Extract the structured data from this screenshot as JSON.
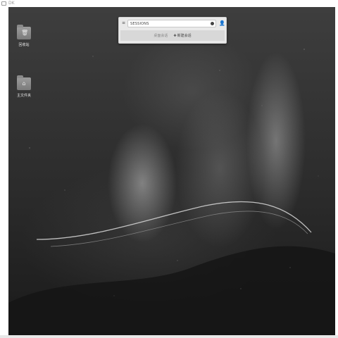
{
  "host_window": {
    "title": "DK"
  },
  "desktop": {
    "icons": [
      {
        "label": "回收站",
        "icon": "trash-icon"
      },
      {
        "label": "主文件夹",
        "icon": "home-icon"
      }
    ]
  },
  "search_panel": {
    "query": "SESSIONS",
    "actions": [
      {
        "label": "桌面会话",
        "enabled": false
      },
      {
        "label": "新建会话",
        "enabled": true
      }
    ]
  },
  "theme": {
    "panel_bg": "#e9e9e9",
    "wallpaper_dark": "#1a1a1a"
  }
}
